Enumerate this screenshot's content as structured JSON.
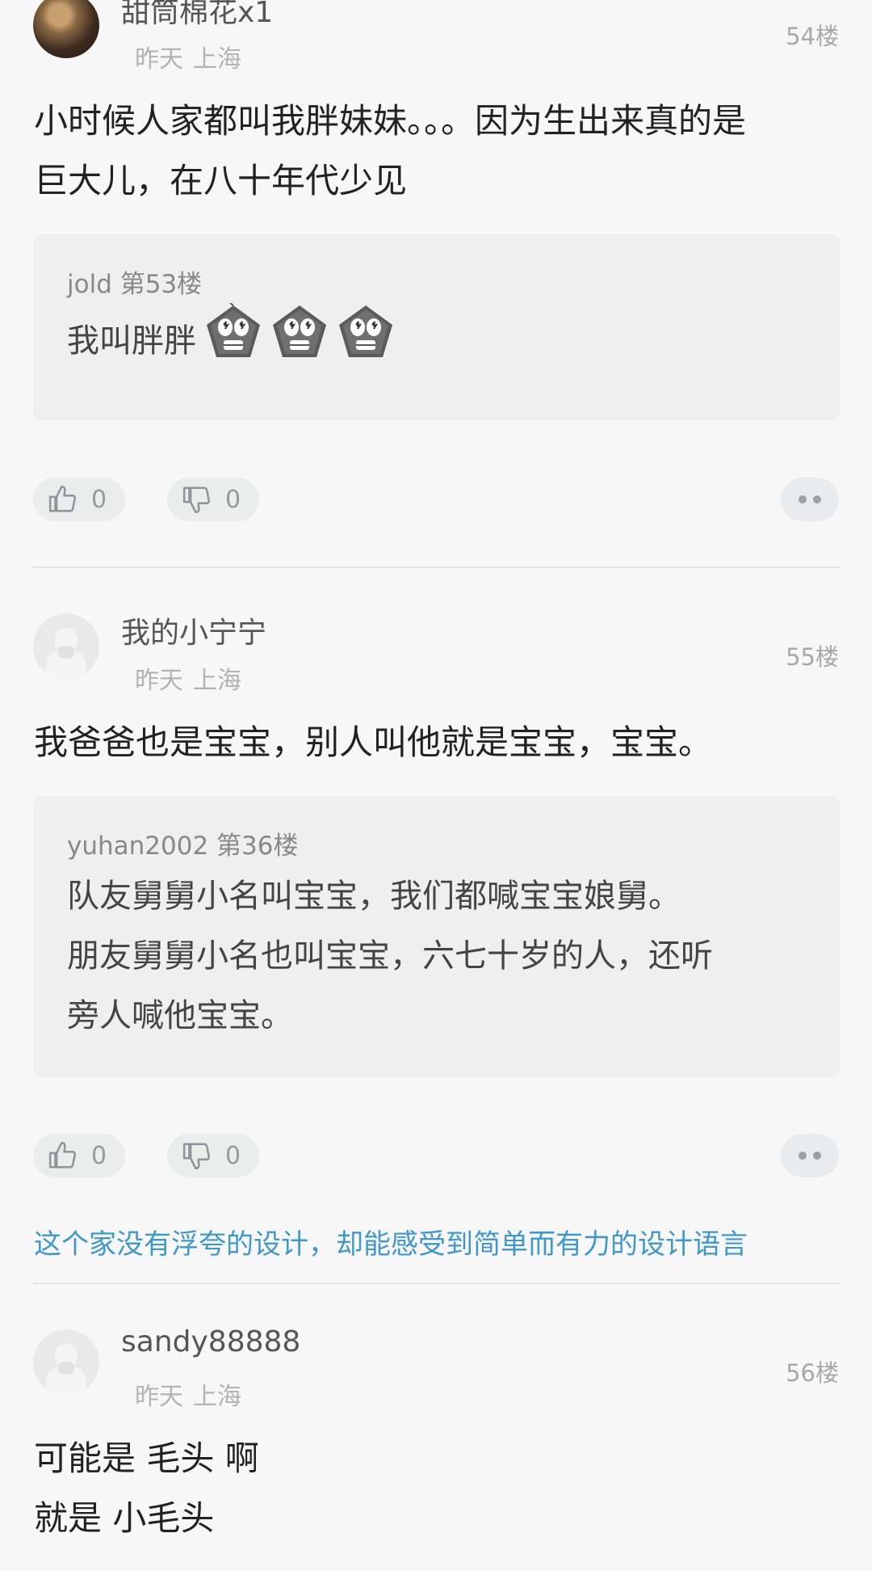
{
  "posts": [
    {
      "username": "甜筒棉花x1",
      "time": "昨天",
      "location": "上海",
      "floor": "54楼",
      "content": [
        "小时候人家都叫我胖妹妹。。。因为生出来真的是",
        "巨大儿，在八十年代少见"
      ],
      "quote": {
        "author": "jold",
        "floor": "第53楼",
        "lines": [
          "我叫胖胖"
        ],
        "emoji": "scared-emoji"
      },
      "likes": "0",
      "dislikes": "0"
    },
    {
      "username": "我的小宁宁",
      "time": "昨天",
      "location": "上海",
      "floor": "55楼",
      "content": [
        "我爸爸也是宝宝，别人叫他就是宝宝，宝宝。"
      ],
      "quote": {
        "author": "yuhan2002",
        "floor": "第36楼",
        "lines": [
          "队友舅舅小名叫宝宝，我们都喊宝宝娘舅。",
          "朋友舅舅小名也叫宝宝，六七十岁的人，还听",
          "旁人喊他宝宝。"
        ]
      },
      "likes": "0",
      "dislikes": "0"
    },
    {
      "username": "sandy88888",
      "time": "昨天",
      "location": "上海",
      "floor": "56楼",
      "content": [
        "可能是 毛头 啊",
        "就是 小毛头"
      ]
    }
  ],
  "ad": {
    "text": "这个家没有浮夸的设计，却能感受到简单而有力的设计语言"
  },
  "icons": {
    "like": "thumbs-up-icon",
    "dislike": "thumbs-down-icon",
    "more": "more-dots-icon"
  },
  "colors": {
    "link": "#3f98c9",
    "background": "#f7f7f7"
  }
}
